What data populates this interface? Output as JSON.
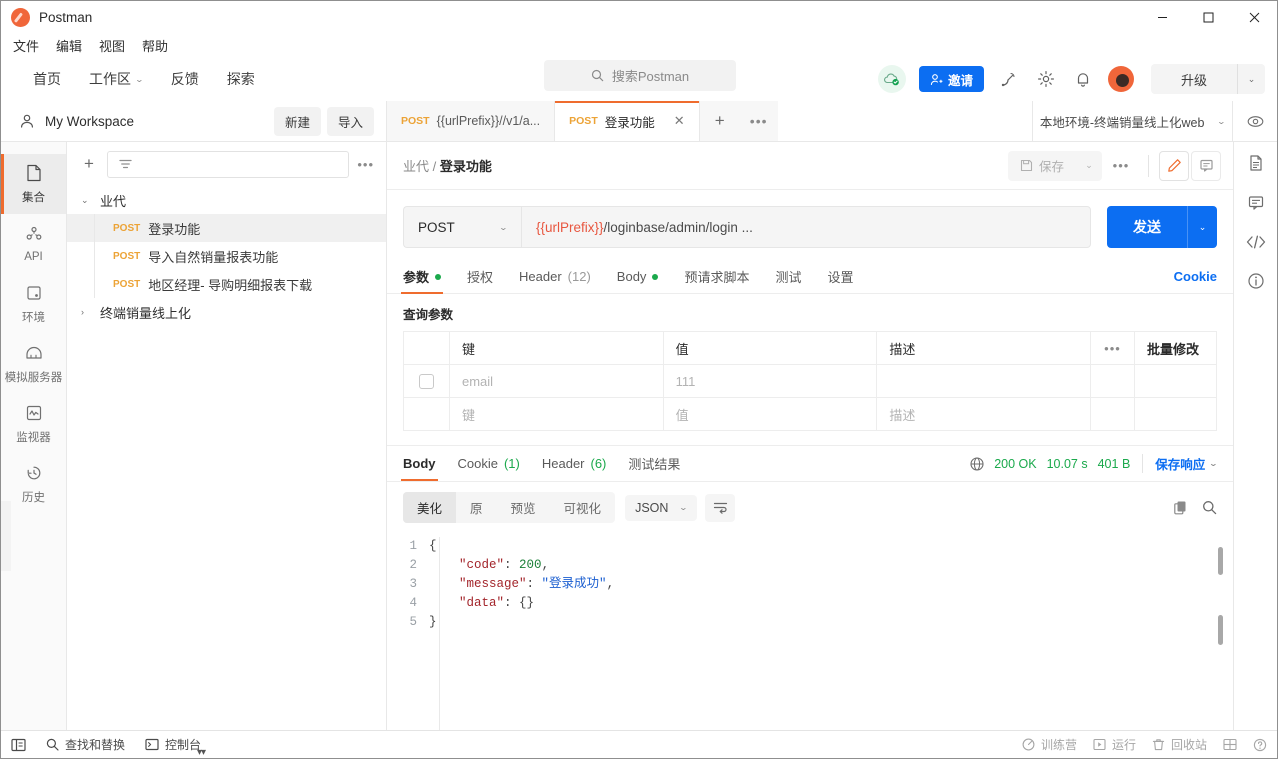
{
  "window": {
    "app_title": "Postman",
    "minimize": "—",
    "maximize": "▢",
    "close": "✕"
  },
  "menubar": {
    "items": [
      "文件",
      "编辑",
      "视图",
      "帮助"
    ]
  },
  "navbar": {
    "items": [
      {
        "label": "首页",
        "has_caret": false
      },
      {
        "label": "工作区",
        "has_caret": true
      },
      {
        "label": "反馈",
        "has_caret": false
      },
      {
        "label": "探索",
        "has_caret": false
      }
    ],
    "search_placeholder": "搜索Postman",
    "invite_label": "邀请",
    "upgrade_label": "升级",
    "upgrade_caret": "⌄"
  },
  "workspace": {
    "name": "My Workspace",
    "new_label": "新建",
    "import_label": "导入"
  },
  "tabs": [
    {
      "method": "POST",
      "title": "{{urlPrefix}}//v1/a...",
      "active": false,
      "closable": false
    },
    {
      "method": "POST",
      "title": "登录功能",
      "active": true,
      "closable": true
    }
  ],
  "tab_actions": {
    "plus": "+",
    "dots": "•••"
  },
  "environment": {
    "selected": "本地环境-终端销量线上化web",
    "caret": "⌄"
  },
  "rail": [
    {
      "label": "集合",
      "icon": "collection-icon",
      "active": true
    },
    {
      "label": "API",
      "icon": "api-icon",
      "active": false
    },
    {
      "label": "环境",
      "icon": "environment-icon",
      "active": false
    },
    {
      "label": "模拟服务器",
      "icon": "mock-server-icon",
      "active": false
    },
    {
      "label": "监视器",
      "icon": "monitor-icon",
      "active": false
    },
    {
      "label": "历史",
      "icon": "history-icon",
      "active": false
    }
  ],
  "collections": {
    "filter_placeholder": "",
    "tree": [
      {
        "type": "folder",
        "label": "业代",
        "expanded": true,
        "caret": "⌄"
      },
      {
        "type": "request",
        "method": "POST",
        "label": "登录功能",
        "selected": true
      },
      {
        "type": "request",
        "method": "POST",
        "label": "导入自然销量报表功能",
        "selected": false
      },
      {
        "type": "request",
        "method": "POST",
        "label": "地区经理- 导购明细报表下载",
        "selected": false
      },
      {
        "type": "folder",
        "label": "终端销量线上化",
        "expanded": false,
        "caret": "›"
      }
    ]
  },
  "request": {
    "breadcrumb_parent": "业代",
    "breadcrumb_sep": "/",
    "breadcrumb_current": "登录功能",
    "save_label": "保存",
    "save_caret": "⌄",
    "more_dots": "•••",
    "method": "POST",
    "method_caret": "⌄",
    "url_var": "{{urlPrefix}}",
    "url_rest": "/loginbase/admin/login ...",
    "send_label": "发送",
    "send_caret": "⌄",
    "tabs": [
      {
        "label": "参数",
        "dot": true,
        "count": "",
        "active": true
      },
      {
        "label": "授权",
        "dot": false,
        "count": "",
        "active": false
      },
      {
        "label": "Header",
        "dot": false,
        "count": "(12)",
        "active": false
      },
      {
        "label": "Body",
        "dot": true,
        "count": "",
        "active": false
      },
      {
        "label": "预请求脚本",
        "dot": false,
        "count": "",
        "active": false
      },
      {
        "label": "测试",
        "dot": false,
        "count": "",
        "active": false
      },
      {
        "label": "设置",
        "dot": false,
        "count": "",
        "active": false
      }
    ],
    "cookie_link": "Cookie",
    "subtab": "查询参数",
    "params_table": {
      "headers": [
        "",
        "键",
        "值",
        "描述",
        "•••",
        "批量修改"
      ],
      "rows": [
        {
          "checked": false,
          "key": "email",
          "value": "111",
          "desc": "",
          "placeholder_row": false
        },
        {
          "checked": null,
          "key": "键",
          "value": "值",
          "desc": "描述",
          "placeholder_row": true
        }
      ]
    }
  },
  "response": {
    "tabs": [
      {
        "label": "Body",
        "count": "",
        "active": true
      },
      {
        "label": "Cookie",
        "count": "(1)",
        "active": false
      },
      {
        "label": "Header",
        "count": "(6)",
        "active": false
      },
      {
        "label": "测试结果",
        "count": "",
        "active": false
      }
    ],
    "status": "200 OK",
    "time": "10.07 s",
    "size": "401 B",
    "save_response_label": "保存响应",
    "save_response_caret": "⌄",
    "view_modes": [
      {
        "label": "美化",
        "active": true
      },
      {
        "label": "原",
        "active": false
      },
      {
        "label": "预览",
        "active": false
      },
      {
        "label": "可视化",
        "active": false
      }
    ],
    "format": "JSON",
    "format_caret": "⌄",
    "body_lines": [
      {
        "num": "1",
        "segments": [
          {
            "t": "{",
            "c": "p"
          }
        ]
      },
      {
        "num": "2",
        "segments": [
          {
            "t": "    ",
            "c": "p"
          },
          {
            "t": "\"code\"",
            "c": "k"
          },
          {
            "t": ": ",
            "c": "p"
          },
          {
            "t": "200",
            "c": "n"
          },
          {
            "t": ",",
            "c": "p"
          }
        ]
      },
      {
        "num": "3",
        "segments": [
          {
            "t": "    ",
            "c": "p"
          },
          {
            "t": "\"message\"",
            "c": "k"
          },
          {
            "t": ": ",
            "c": "p"
          },
          {
            "t": "\"登录成功\"",
            "c": "s"
          },
          {
            "t": ",",
            "c": "p"
          }
        ]
      },
      {
        "num": "4",
        "segments": [
          {
            "t": "    ",
            "c": "p"
          },
          {
            "t": "\"data\"",
            "c": "k"
          },
          {
            "t": ": {}",
            "c": "p"
          }
        ]
      },
      {
        "num": "5",
        "segments": [
          {
            "t": "}",
            "c": "p"
          }
        ]
      }
    ]
  },
  "right_rail": [
    {
      "icon": "documentation-icon",
      "label": "文档"
    },
    {
      "icon": "comment-icon",
      "label": "评论"
    },
    {
      "icon": "code-icon",
      "label": "代码"
    },
    {
      "icon": "info-icon",
      "label": "信息"
    }
  ],
  "footer": {
    "left": [
      {
        "icon": "sidebar-toggle-icon",
        "label": ""
      },
      {
        "icon": "search-icon",
        "label": "查找和替换"
      },
      {
        "icon": "console-icon",
        "label": "控制台"
      }
    ],
    "right": [
      {
        "icon": "bootcamp-icon",
        "label": "训练营"
      },
      {
        "icon": "runner-icon",
        "label": "运行"
      },
      {
        "icon": "trash-icon",
        "label": "回收站"
      },
      {
        "icon": "layout-icon",
        "label": ""
      },
      {
        "icon": "help-icon",
        "label": ""
      }
    ]
  },
  "colors": {
    "accent_orange": "#ef6c2e",
    "blue": "#0c6ef2",
    "green": "#1ba94c",
    "method_post": "#eca336"
  }
}
